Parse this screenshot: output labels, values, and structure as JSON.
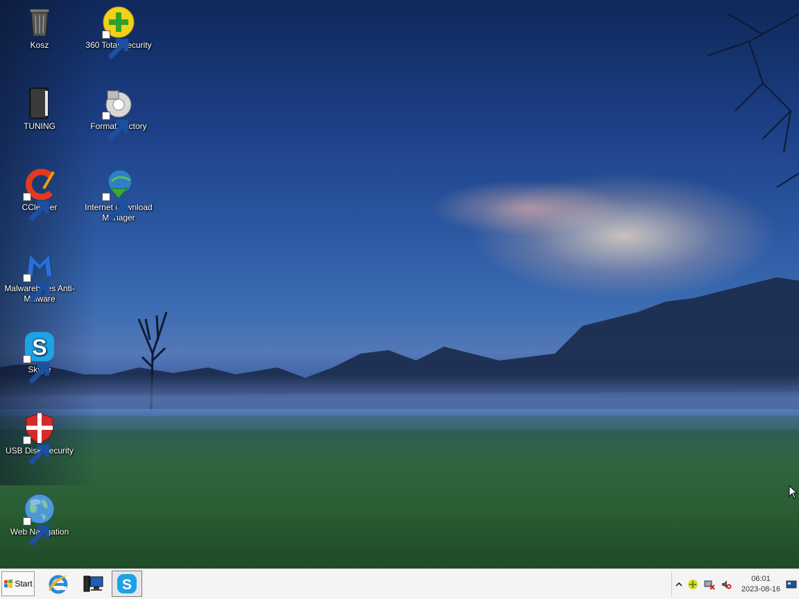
{
  "desktop": {
    "icons": [
      {
        "label": "Kosz",
        "icon": "recycle-bin-icon"
      },
      {
        "label": "360 Total Security",
        "icon": "360-total-security-icon"
      },
      {
        "label": "TUNING",
        "icon": "folder-icon"
      },
      {
        "label": "Format Factory",
        "icon": "format-factory-icon"
      },
      {
        "label": "CCleaner",
        "icon": "ccleaner-icon"
      },
      {
        "label": "Internet Download Manager",
        "icon": "idm-icon"
      },
      {
        "label": "Malwarebytes Anti-Malware",
        "icon": "malwarebytes-icon"
      },
      {
        "label": "Skype",
        "icon": "skype-icon"
      },
      {
        "label": "USB Disk Security",
        "icon": "usb-disk-security-icon"
      },
      {
        "label": "Web Navigation",
        "icon": "globe-icon"
      }
    ]
  },
  "taskbar": {
    "start_label": "Start",
    "pinned": [
      {
        "name": "Internet Explorer",
        "icon": "internet-explorer-icon"
      },
      {
        "name": "Computer",
        "icon": "computer-icon"
      },
      {
        "name": "Skype",
        "icon": "skype-icon",
        "active": true
      }
    ],
    "tray": {
      "icons": [
        "chevron-up-icon",
        "360-total-security-icon",
        "network-disconnected-icon",
        "volume-muted-icon",
        "show-desktop-icon"
      ],
      "time": "06:01",
      "date": "2023-08-16"
    }
  }
}
